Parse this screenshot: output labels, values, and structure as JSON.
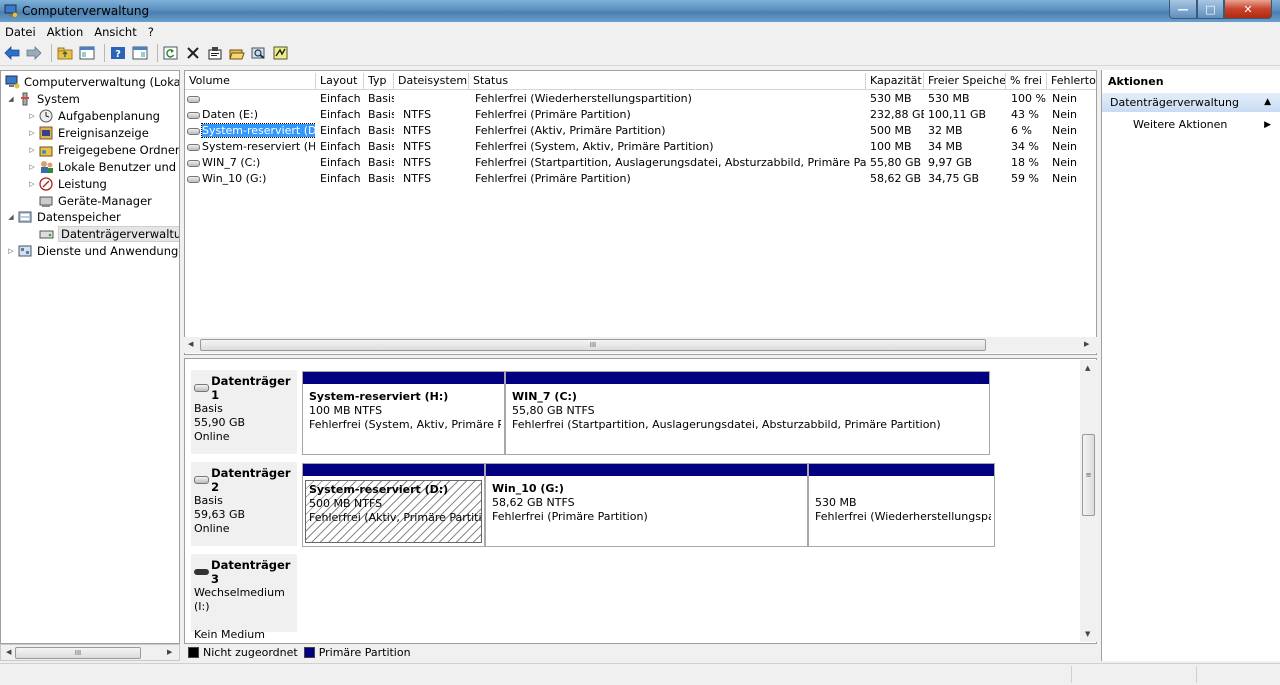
{
  "window": {
    "title": "Computerverwaltung"
  },
  "menu": [
    {
      "label": "Datei"
    },
    {
      "label": "Aktion"
    },
    {
      "label": "Ansicht"
    },
    {
      "label": "?"
    }
  ],
  "tree": {
    "root": "Computerverwaltung (Lokal)",
    "items": [
      {
        "label": "System"
      },
      {
        "label": "Aufgabenplanung"
      },
      {
        "label": "Ereignisanzeige"
      },
      {
        "label": "Freigegebene Ordner"
      },
      {
        "label": "Lokale Benutzer und Gruppen"
      },
      {
        "label": "Leistung"
      },
      {
        "label": "Geräte-Manager"
      },
      {
        "label": "Datenspeicher"
      },
      {
        "label": "Datenträgerverwaltung"
      },
      {
        "label": "Dienste und Anwendungen"
      }
    ]
  },
  "volumes": {
    "columns": [
      "Volume",
      "Layout",
      "Typ",
      "Dateisystem",
      "Status",
      "Kapazität",
      "Freier Speicher",
      "% frei",
      "Fehlertol"
    ],
    "rows": [
      {
        "volume": "",
        "layout": "Einfach",
        "typ": "Basis",
        "fs": "",
        "status": "Fehlerfrei (Wiederherstellungspartition)",
        "cap": "530 MB",
        "free": "530 MB",
        "pct": "100 %",
        "ft": "Nein"
      },
      {
        "volume": "Daten (E:)",
        "layout": "Einfach",
        "typ": "Basis",
        "fs": "NTFS",
        "status": "Fehlerfrei (Primäre Partition)",
        "cap": "232,88 GB",
        "free": "100,11 GB",
        "pct": "43 %",
        "ft": "Nein"
      },
      {
        "volume": "System-reserviert (D:)",
        "layout": "Einfach",
        "typ": "Basis",
        "fs": "NTFS",
        "status": "Fehlerfrei (Aktiv, Primäre Partition)",
        "cap": "500 MB",
        "free": "32 MB",
        "pct": "6 %",
        "ft": "Nein"
      },
      {
        "volume": "System-reserviert (H:)",
        "layout": "Einfach",
        "typ": "Basis",
        "fs": "NTFS",
        "status": "Fehlerfrei (System, Aktiv, Primäre Partition)",
        "cap": "100 MB",
        "free": "34 MB",
        "pct": "34 %",
        "ft": "Nein"
      },
      {
        "volume": "WIN_7 (C:)",
        "layout": "Einfach",
        "typ": "Basis",
        "fs": "NTFS",
        "status": "Fehlerfrei (Startpartition, Auslagerungsdatei, Absturzabbild, Primäre Partition)",
        "cap": "55,80 GB",
        "free": "9,97 GB",
        "pct": "18 %",
        "ft": "Nein"
      },
      {
        "volume": "Win_10 (G:)",
        "layout": "Einfach",
        "typ": "Basis",
        "fs": "NTFS",
        "status": "Fehlerfrei (Primäre Partition)",
        "cap": "58,62 GB",
        "free": "34,75 GB",
        "pct": "59 %",
        "ft": "Nein"
      }
    ],
    "scroll_glyph": "III"
  },
  "disks": [
    {
      "name": "Datenträger 1",
      "type": "Basis",
      "size": "55,90 GB",
      "state": "Online",
      "partitions": [
        {
          "name": "System-reserviert  (H:)",
          "size": "100 MB NTFS",
          "status": "Fehlerfrei (System, Aktiv, Primäre Partition)"
        },
        {
          "name": "WIN_7  (C:)",
          "size": "55,80 GB NTFS",
          "status": "Fehlerfrei (Startpartition, Auslagerungsdatei, Absturzabbild, Primäre Partition)"
        }
      ]
    },
    {
      "name": "Datenträger 2",
      "type": "Basis",
      "size": "59,63 GB",
      "state": "Online",
      "partitions": [
        {
          "name": "System-reserviert  (D:)",
          "size": "500 MB NTFS",
          "status": "Fehlerfrei (Aktiv, Primäre Partition)"
        },
        {
          "name": "Win_10  (G:)",
          "size": "58,62 GB NTFS",
          "status": "Fehlerfrei (Primäre Partition)"
        },
        {
          "name": "",
          "size": "530 MB",
          "status": "Fehlerfrei (Wiederherstellungspartition)"
        }
      ]
    },
    {
      "name": "Datenträger 3",
      "type": "Wechselmedium (I:)",
      "size": "",
      "state": "Kein Medium"
    }
  ],
  "legend": [
    {
      "label": "Nicht zugeordnet",
      "color": "#000000"
    },
    {
      "label": "Primäre Partition",
      "color": "#000080"
    }
  ],
  "actions": {
    "header": "Aktionen",
    "group": "Datenträgerverwaltung",
    "item": "Weitere Aktionen"
  },
  "colors": {
    "accent": "#000080",
    "selection": "#3399ff"
  }
}
